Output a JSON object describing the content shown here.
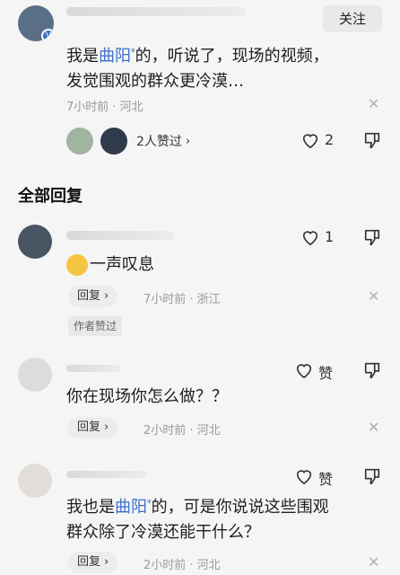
{
  "top_comment": {
    "follow_label": "关注",
    "text_pre": "我是",
    "text_link": "曲阳",
    "text_post": "的，听说了，现场的视频，",
    "text_line2": "发觉围观的群众更冷漠…",
    "meta": "7小时前 · 河北",
    "liked_count_label": "2人赞过",
    "like_count": "2"
  },
  "section_title": "全部回复",
  "replies": [
    {
      "text": "一声叹息",
      "reply_label": "回复",
      "meta": "7小时前 · 浙江",
      "like_count": "1",
      "author_liked_label": "作者赞过"
    },
    {
      "text": "你在现场你怎么做？？",
      "reply_label": "回复",
      "meta": "2小时前 · 河北",
      "like_label": "赞"
    },
    {
      "text_pre": "我也是",
      "text_link": "曲阳",
      "text_post": "的，可是你说说这些围观",
      "text_line2": "群众除了冷漠还能干什么？",
      "reply_label": "回复",
      "meta": "2小时前 · 河北",
      "like_label": "赞"
    }
  ],
  "colors": {
    "link": "#3d6ecb",
    "background": "#f5f5f5"
  }
}
